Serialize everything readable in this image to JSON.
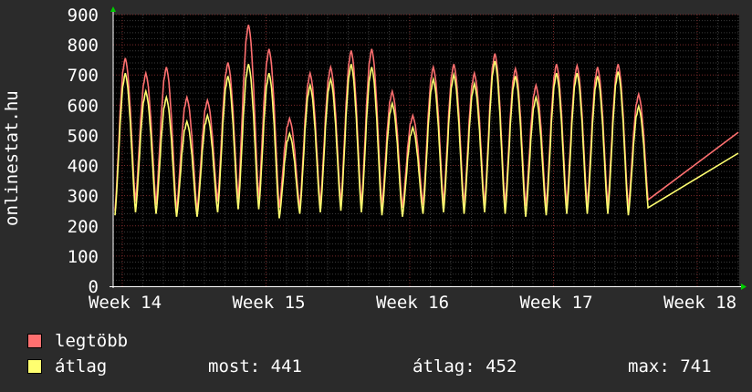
{
  "chart_data": {
    "type": "line",
    "ylabel": "onlinestat.hu",
    "ylim": [
      0,
      900
    ],
    "y_ticks": [
      "0",
      "100",
      "200",
      "300",
      "400",
      "500",
      "600",
      "700",
      "800",
      "900"
    ],
    "x_ticks": [
      "Week 14",
      "Week 15",
      "Week 16",
      "Week 17",
      "Week 18"
    ],
    "days": 31,
    "series": [
      {
        "name": "legtöbb",
        "color": "#ff7070",
        "daily_peak": [
          750,
          700,
          720,
          620,
          610,
          735,
          860,
          780,
          550,
          700,
          720,
          775,
          780,
          640,
          560,
          720,
          730,
          700,
          765,
          715,
          660,
          730,
          725,
          720,
          730,
          630
        ],
        "daily_trough": [
          250,
          280,
          270,
          250,
          250,
          280,
          290,
          290,
          260,
          260,
          270,
          275,
          270,
          265,
          260,
          270,
          275,
          270,
          270,
          270,
          265,
          265,
          270,
          270,
          270,
          260
        ],
        "last": 510
      },
      {
        "name": "átlag",
        "color": "#ffff70",
        "daily_peak": [
          700,
          640,
          620,
          540,
          560,
          690,
          730,
          700,
          500,
          660,
          680,
          730,
          720,
          600,
          520,
          680,
          695,
          665,
          740,
          690,
          620,
          700,
          700,
          690,
          705,
          590
        ],
        "daily_trough": [
          235,
          245,
          240,
          230,
          230,
          245,
          255,
          255,
          225,
          240,
          245,
          250,
          245,
          235,
          230,
          240,
          245,
          240,
          245,
          240,
          230,
          235,
          240,
          240,
          240,
          235
        ],
        "last": 441
      }
    ],
    "legend": [
      {
        "label": "legtöbb",
        "color": "#ff7070"
      },
      {
        "label": "átlag",
        "color": "#ffff70"
      }
    ],
    "stats": {
      "most": "most: 441",
      "atlag": "átlag: 452",
      "max": "max: 741"
    }
  }
}
